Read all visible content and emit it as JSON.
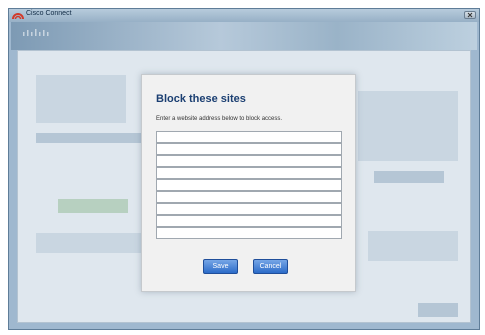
{
  "window": {
    "title": "Cisco Connect"
  },
  "dialog": {
    "title": "Block these sites",
    "instructions": "Enter a website address below to block access.",
    "site_inputs": [
      "",
      "",
      "",
      "",
      "",
      "",
      "",
      "",
      ""
    ],
    "save_label": "Save",
    "cancel_label": "Cancel"
  },
  "colors": {
    "dialog_title": "#1b3f72",
    "button": "#2c6cc9",
    "window_frame": "#9fb8cf"
  },
  "icons": {
    "app": "cisco-logo-icon",
    "close": "close-icon"
  }
}
